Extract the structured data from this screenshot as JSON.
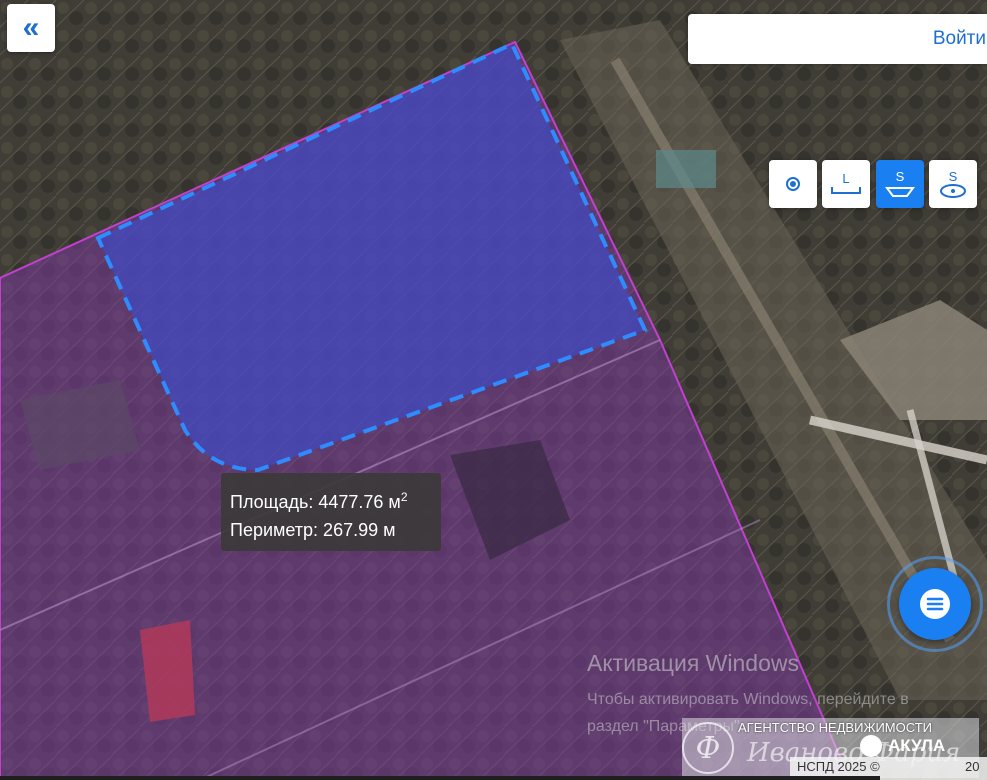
{
  "header": {
    "collapse_icon": "double-chevron-left-icon",
    "login_label": "Войти"
  },
  "tools": [
    {
      "id": "point",
      "icon": "point-measure-icon",
      "label": "",
      "active": false
    },
    {
      "id": "length",
      "icon": "length-measure-icon",
      "label": "L",
      "active": false
    },
    {
      "id": "area",
      "icon": "area-measure-icon",
      "label": "S",
      "active": true
    },
    {
      "id": "circle-area",
      "icon": "circle-area-measure-icon",
      "label": "S",
      "active": false
    }
  ],
  "measurement": {
    "area_prefix": "Площадь: ",
    "area_value": "4477.76 м",
    "area_sup": "2",
    "perimeter_text": "Периметр: 267.99 м"
  },
  "chat": {
    "icon": "chat-icon"
  },
  "watermark": {
    "title": "Активация Windows",
    "line1": "Чтобы активировать Windows, перейдите в",
    "line2": "раздел \"Параметры\"."
  },
  "branding": {
    "agency_text": "АГЕНТСТВО НЕДВИЖИМОСТИ",
    "script_text": "Иваново-Фария",
    "logo_letter": "Ф",
    "akula_text": "АКУЛА"
  },
  "footer": {
    "copyright": "НСПД 2025 ©",
    "scale_prefix": "20"
  },
  "colors": {
    "accent": "#1a7ff0",
    "parcel_fill": "#7a3a9a",
    "parcel_border": "#c23fd0",
    "measure_fill": "#3b4fd6",
    "measure_stroke": "#2f8cff"
  }
}
